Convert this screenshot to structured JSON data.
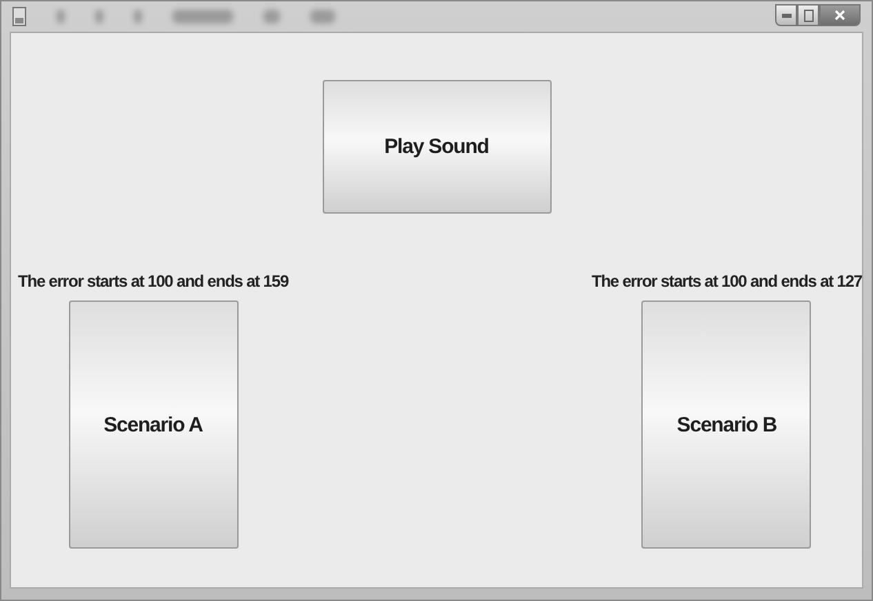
{
  "play_button": {
    "label": "Play Sound"
  },
  "scenarios": [
    {
      "caption": "The error starts at 100 and ends at 159",
      "button": "Scenario A"
    },
    {
      "caption": "The error starts at 100 and ends at 127",
      "button": "Scenario B"
    }
  ]
}
